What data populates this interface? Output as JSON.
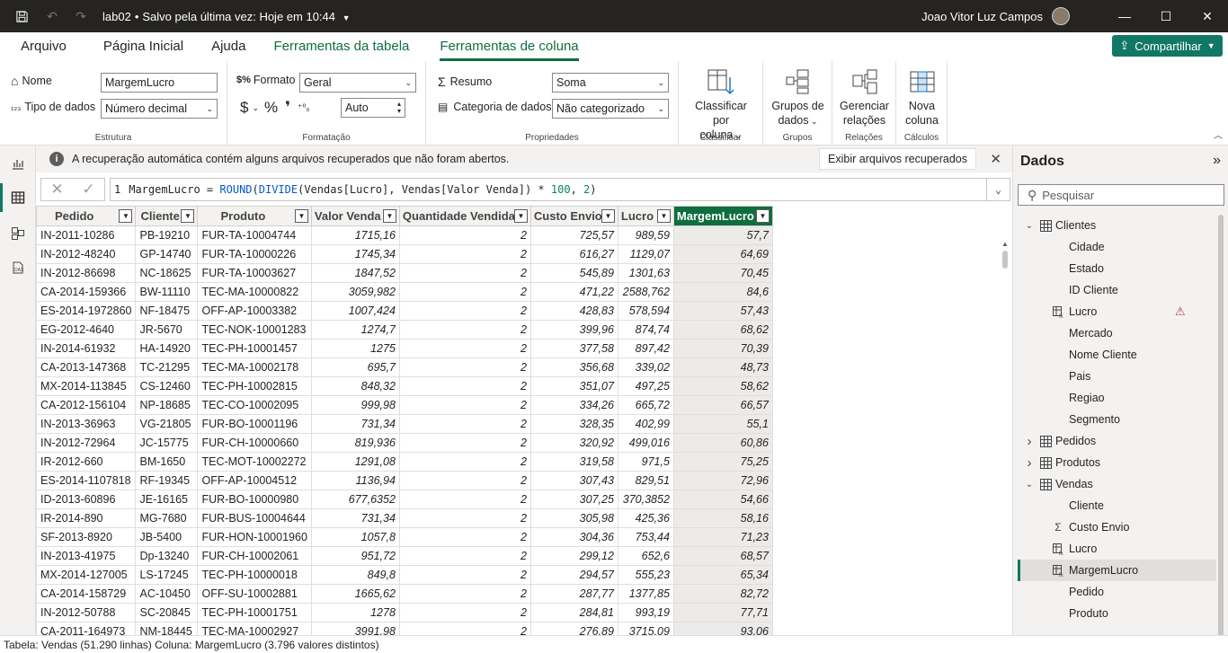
{
  "titlebar": {
    "file_name": "lab02",
    "separator": "•",
    "save_status": "Salvo pela última vez: Hoje em 10:44",
    "user_name": "Joao Vitor Luz Campos"
  },
  "menu": {
    "tabs": [
      "Arquivo",
      "Página Inicial",
      "Ajuda",
      "Ferramentas da tabela",
      "Ferramentas de coluna"
    ],
    "share_label": "Compartilhar"
  },
  "ribbon": {
    "estrutura": {
      "nome_label": "Nome",
      "nome_value": "MargemLucro",
      "tipo_label": "Tipo de dados",
      "tipo_value": "Número decimal",
      "group_label": "Estrutura"
    },
    "formatacao": {
      "formato_label": "Formato",
      "formato_value": "Geral",
      "currency_symbol": "$",
      "percent_symbol": "%",
      "comma_symbol": "❜",
      "decimals_value": "Auto",
      "group_label": "Formatação"
    },
    "propriedades": {
      "resumo_label": "Resumo",
      "resumo_value": "Soma",
      "categoria_label": "Categoria de dados",
      "categoria_value": "Não categorizado",
      "group_label": "Propriedades"
    },
    "classificar": {
      "button_line1": "Classificar por",
      "button_line2": "coluna",
      "group_label": "Classificar"
    },
    "grupos": {
      "button_line1": "Grupos de",
      "button_line2": "dados",
      "group_label": "Grupos"
    },
    "relacoes": {
      "button_line1": "Gerenciar",
      "button_line2": "relações",
      "group_label": "Relações"
    },
    "calculos": {
      "button_line1": "Nova",
      "button_line2": "coluna",
      "group_label": "Cálculos"
    }
  },
  "infobar": {
    "icon_text": "i",
    "message": "A recuperação automática contém alguns arquivos recuperados que não foram abertos.",
    "button_label": "Exibir arquivos recuperados"
  },
  "formula": {
    "line_number": "1",
    "p1": "MargemLucro = ",
    "fn1": "ROUND",
    "p2": "(",
    "fn2": "DIVIDE",
    "p3": "(Vendas[Lucro], Vendas[Valor Venda]) * ",
    "n1": "100",
    "p4": ", ",
    "n2": "2",
    "p5": ")"
  },
  "table": {
    "headers": [
      "Pedido",
      "Cliente",
      "Produto",
      "Valor Venda",
      "Quantidade Vendida",
      "Custo Envio",
      "Lucro",
      "MargemLucro"
    ],
    "rows": [
      [
        "IN-2011-10286",
        "PB-19210",
        "FUR-TA-10004744",
        "1715,16",
        "2",
        "725,57",
        "989,59",
        "57,7"
      ],
      [
        "IN-2012-48240",
        "GP-14740",
        "FUR-TA-10000226",
        "1745,34",
        "2",
        "616,27",
        "1129,07",
        "64,69"
      ],
      [
        "IN-2012-86698",
        "NC-18625",
        "FUR-TA-10003627",
        "1847,52",
        "2",
        "545,89",
        "1301,63",
        "70,45"
      ],
      [
        "CA-2014-159366",
        "BW-11110",
        "TEC-MA-10000822",
        "3059,982",
        "2",
        "471,22",
        "2588,762",
        "84,6"
      ],
      [
        "ES-2014-1972860",
        "NF-18475",
        "OFF-AP-10003382",
        "1007,424",
        "2",
        "428,83",
        "578,594",
        "57,43"
      ],
      [
        "EG-2012-4640",
        "JR-5670",
        "TEC-NOK-10001283",
        "1274,7",
        "2",
        "399,96",
        "874,74",
        "68,62"
      ],
      [
        "IN-2014-61932",
        "HA-14920",
        "TEC-PH-10001457",
        "1275",
        "2",
        "377,58",
        "897,42",
        "70,39"
      ],
      [
        "CA-2013-147368",
        "TC-21295",
        "TEC-MA-10002178",
        "695,7",
        "2",
        "356,68",
        "339,02",
        "48,73"
      ],
      [
        "MX-2014-113845",
        "CS-12460",
        "TEC-PH-10002815",
        "848,32",
        "2",
        "351,07",
        "497,25",
        "58,62"
      ],
      [
        "CA-2012-156104",
        "NP-18685",
        "TEC-CO-10002095",
        "999,98",
        "2",
        "334,26",
        "665,72",
        "66,57"
      ],
      [
        "IN-2013-36963",
        "VG-21805",
        "FUR-BO-10001196",
        "731,34",
        "2",
        "328,35",
        "402,99",
        "55,1"
      ],
      [
        "IN-2012-72964",
        "JC-15775",
        "FUR-CH-10000660",
        "819,936",
        "2",
        "320,92",
        "499,016",
        "60,86"
      ],
      [
        "IR-2012-660",
        "BM-1650",
        "TEC-MOT-10002272",
        "1291,08",
        "2",
        "319,58",
        "971,5",
        "75,25"
      ],
      [
        "ES-2014-1107818",
        "RF-19345",
        "OFF-AP-10004512",
        "1136,94",
        "2",
        "307,43",
        "829,51",
        "72,96"
      ],
      [
        "ID-2013-60896",
        "JE-16165",
        "FUR-BO-10000980",
        "677,6352",
        "2",
        "307,25",
        "370,3852",
        "54,66"
      ],
      [
        "IR-2014-890",
        "MG-7680",
        "FUR-BUS-10004644",
        "731,34",
        "2",
        "305,98",
        "425,36",
        "58,16"
      ],
      [
        "SF-2013-8920",
        "JB-5400",
        "FUR-HON-10001960",
        "1057,8",
        "2",
        "304,36",
        "753,44",
        "71,23"
      ],
      [
        "IN-2013-41975",
        "Dp-13240",
        "FUR-CH-10002061",
        "951,72",
        "2",
        "299,12",
        "652,6",
        "68,57"
      ],
      [
        "MX-2014-127005",
        "LS-17245",
        "TEC-PH-10000018",
        "849,8",
        "2",
        "294,57",
        "555,23",
        "65,34"
      ],
      [
        "CA-2014-158729",
        "AC-10450",
        "OFF-SU-10002881",
        "1665,62",
        "2",
        "287,77",
        "1377,85",
        "82,72"
      ],
      [
        "IN-2012-50788",
        "SC-20845",
        "TEC-PH-10001751",
        "1278",
        "2",
        "284,81",
        "993,19",
        "77,71"
      ],
      [
        "CA-2011-164973",
        "NM-18445",
        "TEC-MA-10002927",
        "3991,98",
        "2",
        "276,89",
        "3715,09",
        "93,06"
      ]
    ]
  },
  "right_panel": {
    "title": "Dados",
    "search_placeholder": "Pesquisar",
    "tree": [
      {
        "label": "Clientes",
        "level": 0,
        "kind": "table",
        "expanded": true
      },
      {
        "label": "Cidade",
        "level": 1,
        "kind": "field"
      },
      {
        "label": "Estado",
        "level": 1,
        "kind": "field"
      },
      {
        "label": "ID Cliente",
        "level": 1,
        "kind": "field"
      },
      {
        "label": "Lucro",
        "level": 1,
        "kind": "calc",
        "warning": true
      },
      {
        "label": "Mercado",
        "level": 1,
        "kind": "field"
      },
      {
        "label": "Nome Cliente",
        "level": 1,
        "kind": "field"
      },
      {
        "label": "Pais",
        "level": 1,
        "kind": "field"
      },
      {
        "label": "Regiao",
        "level": 1,
        "kind": "field"
      },
      {
        "label": "Segmento",
        "level": 1,
        "kind": "field"
      },
      {
        "label": "Pedidos",
        "level": 0,
        "kind": "table",
        "expanded": false
      },
      {
        "label": "Produtos",
        "level": 0,
        "kind": "table",
        "expanded": false
      },
      {
        "label": "Vendas",
        "level": 0,
        "kind": "table",
        "expanded": true
      },
      {
        "label": "Cliente",
        "level": 1,
        "kind": "field"
      },
      {
        "label": "Custo Envio",
        "level": 1,
        "kind": "sum"
      },
      {
        "label": "Lucro",
        "level": 1,
        "kind": "calc"
      },
      {
        "label": "MargemLucro",
        "level": 1,
        "kind": "calc",
        "selected": true
      },
      {
        "label": "Pedido",
        "level": 1,
        "kind": "field"
      },
      {
        "label": "Produto",
        "level": 1,
        "kind": "field"
      }
    ]
  },
  "status": {
    "text": "Tabela: Vendas (51.290 linhas) Coluna: MargemLucro (3.796 valores distintos)"
  },
  "colors": {
    "accent": "#117865",
    "context_tab": "#0f6e3f",
    "titlebar": "#252423",
    "arrow": "#e81123"
  },
  "icons": {
    "save": "save-icon",
    "undo": "undo-icon",
    "redo": "redo-icon"
  }
}
